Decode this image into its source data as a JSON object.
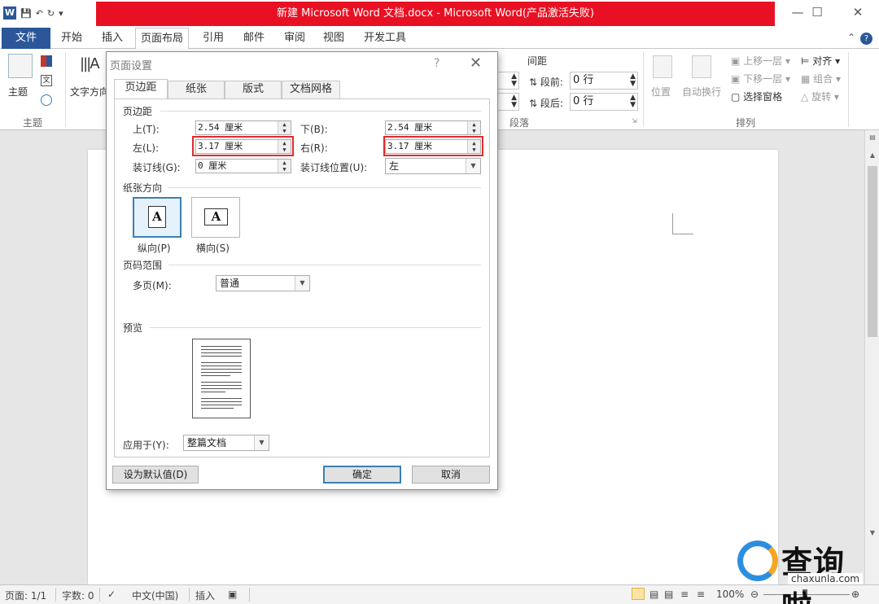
{
  "app": {
    "window_title": "新建 Microsoft Word 文档.docx - Microsoft Word(产品激活失败)",
    "app_letter": "W"
  },
  "ribbon_tabs": [
    "文件",
    "开始",
    "插入",
    "页面布局",
    "引用",
    "邮件",
    "审阅",
    "视图",
    "开发工具"
  ],
  "ribbon": {
    "theme_label": "主题",
    "theme_group": "主题",
    "text_direction_label": "文字方向",
    "spacing_header": "间距",
    "before_label": "段前:",
    "before_value": "0 行",
    "after_label": "段后:",
    "after_value": "0 行",
    "paragraph_group": "段落",
    "position_label": "位置",
    "wrap_label": "自动换行",
    "bring_forward": "上移一层",
    "send_backward": "下移一层",
    "selection_pane": "选择窗格",
    "align": "对齐",
    "group": "组合",
    "rotate": "旋转",
    "arrange_group": "排列"
  },
  "dialog": {
    "title": "页面设置",
    "help": "?",
    "tabs": [
      "页边距",
      "纸张",
      "版式",
      "文档网格"
    ],
    "margins_section": "页边距",
    "top_label": "上(T):",
    "top_value": "2.54 厘米",
    "bottom_label": "下(B):",
    "bottom_value": "2.54 厘米",
    "left_label": "左(L):",
    "left_value": "3.17 厘米",
    "right_label": "右(R):",
    "right_value": "3.17 厘米",
    "gutter_label": "装订线(G):",
    "gutter_value": "0 厘米",
    "gutter_pos_label": "装订线位置(U):",
    "gutter_pos_value": "左",
    "orientation_section": "纸张方向",
    "portrait_label": "纵向(P)",
    "landscape_label": "横向(S)",
    "orientation_glyph": "A",
    "pages_section": "页码范围",
    "multiple_pages_label": "多页(M):",
    "multiple_pages_value": "普通",
    "preview_section": "预览",
    "apply_to_label": "应用于(Y):",
    "apply_to_value": "整篇文档",
    "set_default_button": "设为默认值(D)",
    "ok_button": "确定",
    "cancel_button": "取消"
  },
  "statusbar": {
    "page": "页面: 1/1",
    "words": "字数: 0",
    "language": "中文(中国)",
    "mode": "插入",
    "zoom": "100%"
  },
  "watermark": {
    "text": "查询啦",
    "url": "chaxunla.com"
  }
}
